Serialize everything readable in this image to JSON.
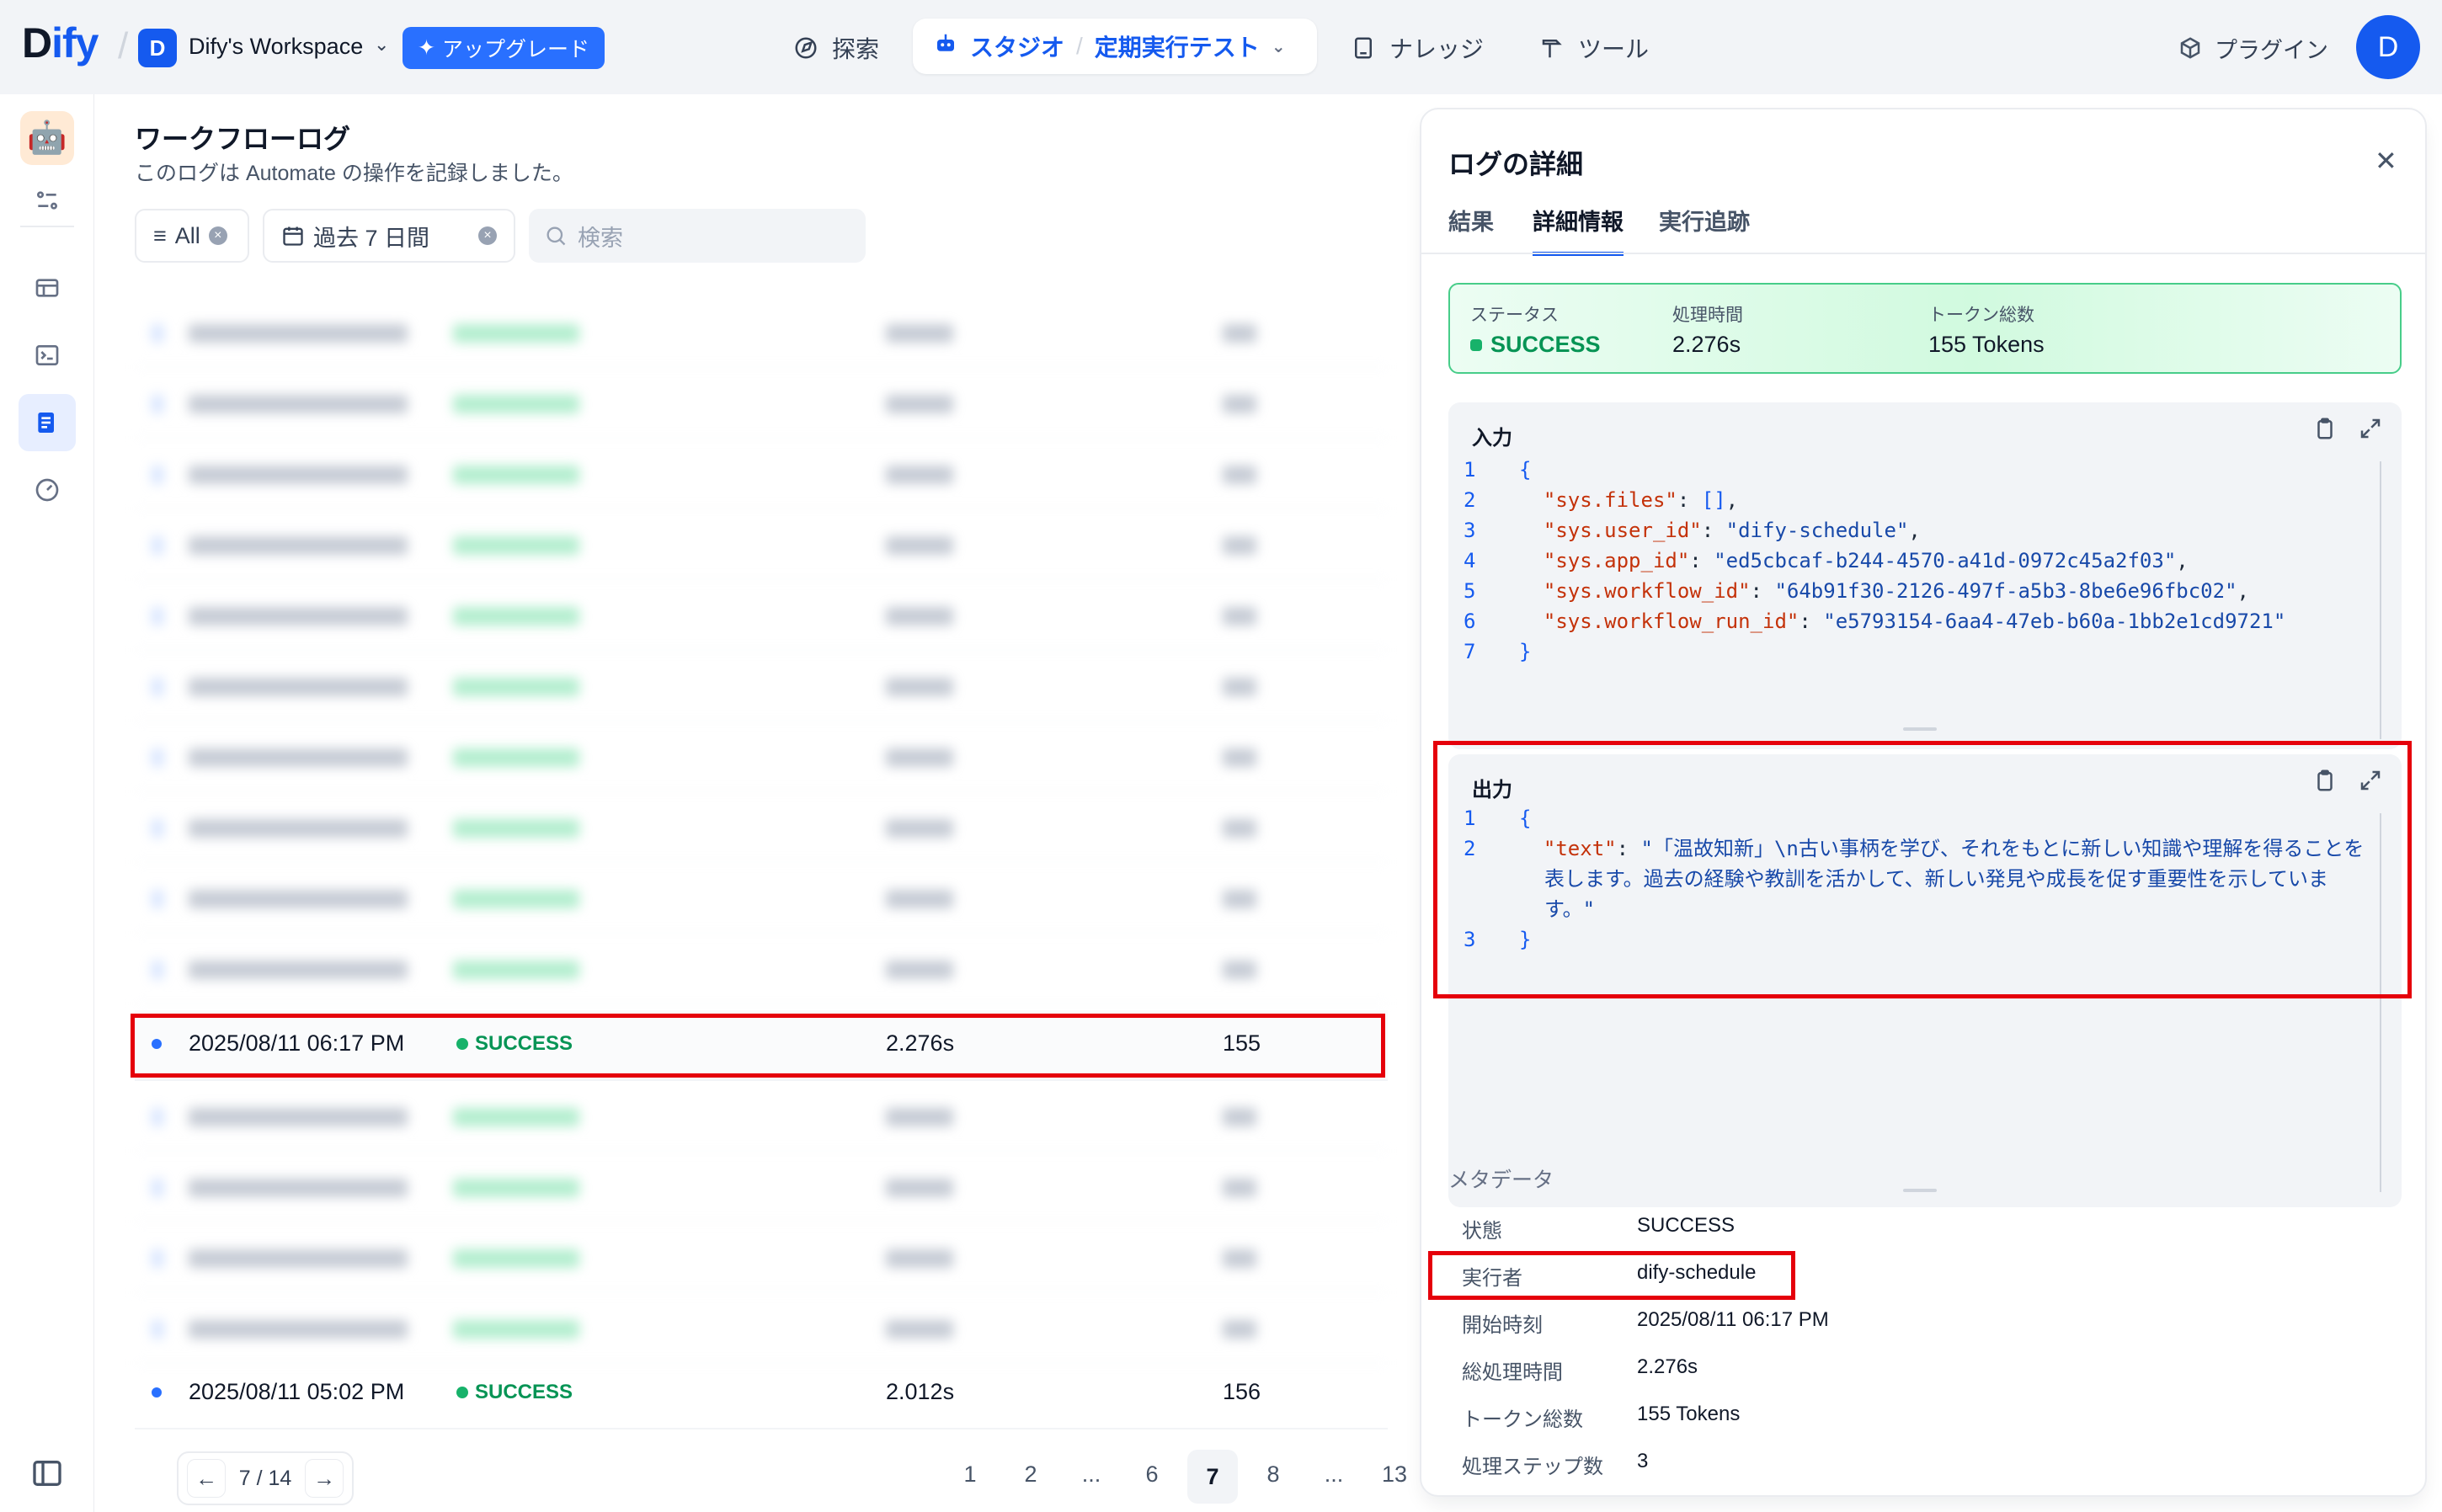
{
  "nav": {
    "logo_dark": "D",
    "logo_blue": "ify",
    "workspace_initial": "D",
    "workspace_name": "Dify's Workspace",
    "upgrade_label": "アップグレード",
    "explore_label": "探索",
    "studio_label": "スタジオ",
    "app_name": "定期実行テスト",
    "knowledge_label": "ナレッジ",
    "tools_label": "ツール",
    "plugin_label": "プラグイン",
    "user_initial": "D",
    "accent": "#155aef"
  },
  "logs": {
    "title": "ワークフローログ",
    "subtitle": "このログは Automate の操作を記録しました。",
    "filter_status": "All",
    "filter_period": "過去 7 日間",
    "search_placeholder": "検索",
    "highlighted_row": {
      "time": "2025/08/11 06:17 PM",
      "status": "SUCCESS",
      "duration": "2.276s",
      "tokens": "155"
    },
    "last_row": {
      "time": "2025/08/11 05:02 PM",
      "status": "SUCCESS",
      "duration": "2.012s",
      "tokens": "156"
    },
    "pagination": {
      "current_of_total": "7 / 14",
      "pages": [
        "1",
        "2",
        "...",
        "6",
        "7",
        "8",
        "...",
        "13"
      ],
      "active": "7"
    }
  },
  "detail": {
    "title": "ログの詳細",
    "tabs": [
      "結果",
      "詳細情報",
      "実行追跡"
    ],
    "active_tab": "詳細情報",
    "status_card": {
      "status_label": "ステータス",
      "status_value": "SUCCESS",
      "time_label": "処理時間",
      "time_value": "2.276s",
      "tokens_label": "トークン総数",
      "tokens_value": "155 Tokens"
    },
    "input": {
      "label": "入力",
      "line_numbers": [
        "1",
        "2",
        "3",
        "4",
        "5",
        "6",
        "7"
      ],
      "sys_files_key": "\"sys.files\"",
      "sys_files_val": "[]",
      "user_id_key": "\"sys.user_id\"",
      "user_id_val": "\"dify-schedule\"",
      "app_id_key": "\"sys.app_id\"",
      "app_id_val": "\"ed5cbcaf-b244-4570-a41d-0972c45a2f03\"",
      "workflow_id_key": "\"sys.workflow_id\"",
      "workflow_id_val": "\"64b91f30-2126-497f-a5b3-8be6e96fbc02\"",
      "run_id_key": "\"sys.workflow_run_id\"",
      "run_id_val": "\"e5793154-6aa4-47eb-b60a-1bb2e1cd9721\""
    },
    "output": {
      "label": "出力",
      "line_numbers": [
        "1",
        "2",
        "3"
      ],
      "text_key": "\"text\"",
      "text_line1": "\"「温故知新」\\n古い事柄を学び、それをもとに新しい知識や理解を得ることを",
      "text_line2": "表します。過去の経験や教訓を活かして、新しい発見や成長を促す重要性を示していま",
      "text_line3": "す。\""
    },
    "metadata": {
      "title": "メタデータ",
      "state_label": "状態",
      "state_value": "SUCCESS",
      "executor_label": "実行者",
      "executor_value": "dify-schedule",
      "start_label": "開始時刻",
      "start_value": "2025/08/11 06:17 PM",
      "total_time_label": "総処理時間",
      "total_time_value": "2.276s",
      "tokens_label": "トークン総数",
      "tokens_value": "155 Tokens",
      "steps_label": "処理ステップ数",
      "steps_value": "3"
    }
  }
}
